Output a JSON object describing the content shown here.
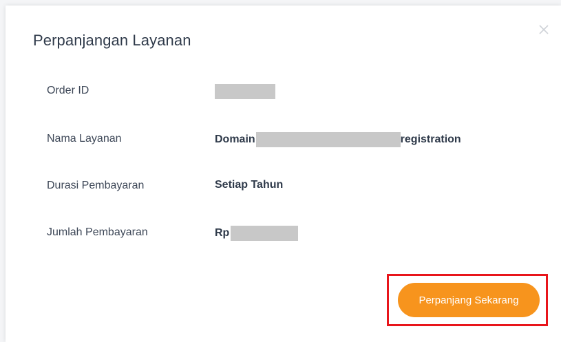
{
  "dialog": {
    "title": "Perpanjangan Layanan"
  },
  "rows": [
    {
      "label": "Order ID",
      "value_prefix": "",
      "value_suffix": ""
    },
    {
      "label": "Nama Layanan",
      "value_prefix": "Domain",
      "value_suffix": "registration"
    },
    {
      "label": "Durasi Pembayaran",
      "value_prefix": "Setiap Tahun",
      "value_suffix": ""
    },
    {
      "label": "Jumlah Pembayaran",
      "value_prefix": "Rp",
      "value_suffix": ""
    }
  ],
  "actions": {
    "renew_label": "Perpanjang Sekarang"
  },
  "icons": {
    "close": "close-icon"
  },
  "colors": {
    "accent": "#f7941d",
    "highlight": "#e8151b",
    "redaction": "#c8c8c8"
  }
}
